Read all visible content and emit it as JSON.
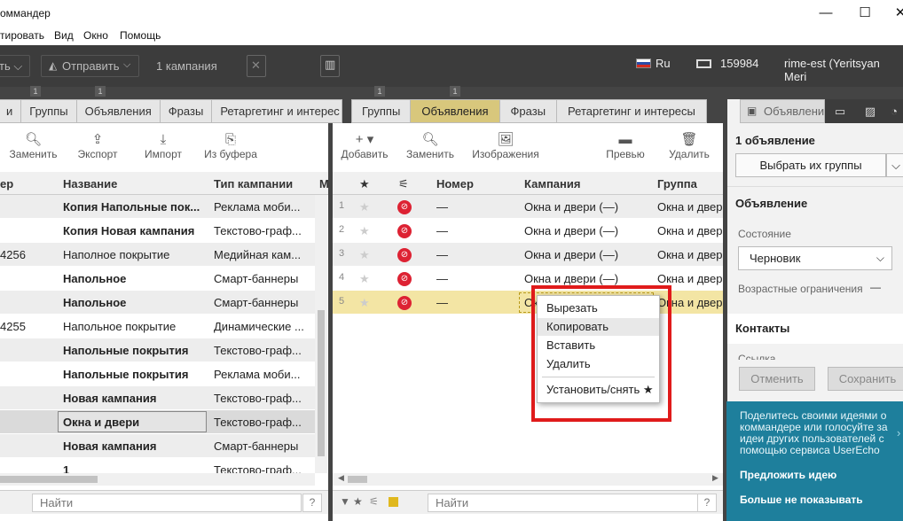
{
  "window": {
    "title": "оммандер",
    "minimize_icon": "—",
    "maximize_icon": "☐",
    "close_icon": "✕"
  },
  "menu": [
    "тировать",
    "Вид",
    "Окно",
    "Помощь"
  ],
  "toolbar": {
    "dropdown_left": "ть ⌵",
    "send_label": "Отправить",
    "campaign_count": "1 кампания",
    "language": "Ru",
    "balance": "159984",
    "user": "rime-est (Yeritsyan Meri"
  },
  "left_panel": {
    "tab_badges": [
      "1",
      "1"
    ],
    "tabs": [
      "и",
      "Группы",
      "Объявления",
      "Фразы",
      "Ретаргетинг и интерес"
    ],
    "tools": [
      {
        "icon": "search-icon",
        "label": "Заменить"
      },
      {
        "icon": "export-icon",
        "label": "Экспорт"
      },
      {
        "icon": "import-icon",
        "label": "Импорт"
      },
      {
        "icon": "clipboard-icon",
        "label": "Из буфера"
      }
    ],
    "columns": [
      "ер",
      "Название",
      "Тип кампании",
      "М"
    ],
    "rows": [
      {
        "num": "",
        "name": "Копия Напольные пок...",
        "type": "Реклама моби...",
        "bold": true
      },
      {
        "num": "",
        "name": "Копия Новая кампания",
        "type": "Текстово-граф...",
        "bold": true
      },
      {
        "num": "4256",
        "name": "Наполное покрытие",
        "type": "Медийная кам...",
        "bold": false
      },
      {
        "num": "",
        "name": "Напольное",
        "type": "Смарт-баннеры",
        "bold": true
      },
      {
        "num": "",
        "name": "Напольное",
        "type": "Смарт-баннеры",
        "bold": true
      },
      {
        "num": "4255",
        "name": "Напольное покрытие",
        "type": "Динамические ...",
        "bold": false
      },
      {
        "num": "",
        "name": "Напольные покрытия",
        "type": "Текстово-граф...",
        "bold": true
      },
      {
        "num": "",
        "name": "Напольные покрытия",
        "type": "Реклама моби...",
        "bold": true
      },
      {
        "num": "",
        "name": "Новая кампания",
        "type": "Текстово-граф...",
        "bold": true
      },
      {
        "num": "",
        "name": "Окна и двери",
        "type": "Текстово-граф...",
        "bold": true
      },
      {
        "num": "",
        "name": "Новая кампания",
        "type": "Смарт-баннеры",
        "bold": true
      },
      {
        "num": "",
        "name": "1",
        "type": "Текстово-граф...",
        "bold": true
      }
    ],
    "search_placeholder": "Найти",
    "help": "?"
  },
  "center_panel": {
    "tab_badges": [
      "1",
      "1"
    ],
    "tabs": [
      "Группы",
      "Объявления",
      "Фразы",
      "Ретаргетинг и интересы"
    ],
    "tools": [
      {
        "icon": "plus-icon",
        "label": "Добавить"
      },
      {
        "icon": "search-icon",
        "label": "Заменить"
      },
      {
        "icon": "image-icon",
        "label": "Изображения"
      },
      {
        "icon": "preview-icon",
        "label": "Превью"
      },
      {
        "icon": "trash-icon",
        "label": "Удалить"
      }
    ],
    "columns": [
      "★",
      "Номер",
      "Кампания",
      "Группа"
    ],
    "rows": [
      {
        "idx": "1",
        "number": "—",
        "campaign": "Окна и двери (—)",
        "group": "Окна и двер"
      },
      {
        "idx": "2",
        "number": "—",
        "campaign": "Окна и двери (—)",
        "group": "Окна и двер"
      },
      {
        "idx": "3",
        "number": "—",
        "campaign": "Окна и двери (—)",
        "group": "Окна и двер"
      },
      {
        "idx": "4",
        "number": "—",
        "campaign": "Окна и двери (—)",
        "group": "Окна и двер"
      },
      {
        "idx": "5",
        "number": "—",
        "campaign": "Ок",
        "group": "Окна и двер"
      }
    ],
    "search_placeholder": "Найти",
    "help": "?"
  },
  "context_menu": {
    "items": [
      "Вырезать",
      "Копировать",
      "Вставить",
      "Удалить"
    ],
    "toggle_star": "Установить/снять ★",
    "hovered_index": 1
  },
  "sidebar": {
    "tab_label": "Объявлени",
    "count_title": "1 объявление",
    "select_groups": "Выбрать их группы",
    "ad_section": "Объявление",
    "state_label": "Состояние",
    "state_value": "Черновик",
    "age_label": "Возрастные ограничения",
    "age_value": "—",
    "contacts_section": "Контакты",
    "link_label": "Ссылка",
    "cancel": "Отменить",
    "save": "Сохранить",
    "promo_text": "Поделитесь своими идеями о коммандере или голосуйте за идеи других пользователей с помощью сервиса UserEcho",
    "promo_suggest": "Предложить идею",
    "promo_hide": "Больше не показывать"
  },
  "colors": {
    "accent_tab": "#d8c77c",
    "highlight_row": "#f3e5a4",
    "toolbar_dark": "#3c3c3c",
    "promo_bg": "#1e7f9c",
    "red_frame": "#e01b1b"
  }
}
